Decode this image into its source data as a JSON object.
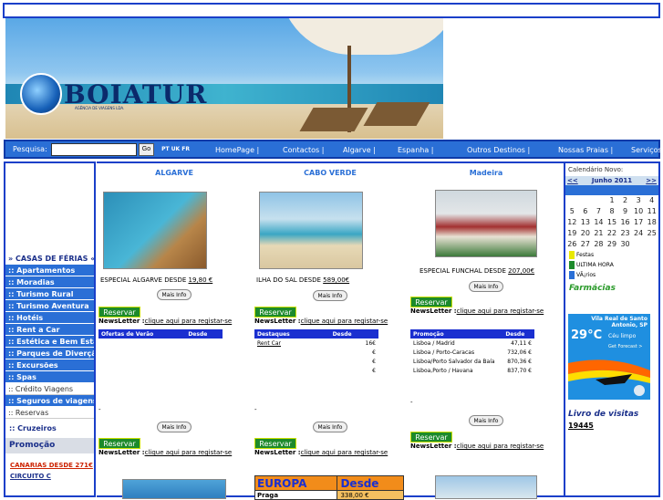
{
  "brand": {
    "name": "BOIATUR",
    "subtitle": "AGÊNCIA DE VIAGENS LDA."
  },
  "nav": {
    "search_label": "Pesquisa:",
    "go": "Go",
    "langs": "PT UK FR",
    "links": [
      "HomePage",
      "Contactos",
      "Algarve",
      "Espanha",
      "Outros Destinos",
      "Nossas Praias",
      "Serviços"
    ]
  },
  "sidebar": {
    "items": [
      {
        "label": "» CASAS DE FÉRIAS «",
        "style": "white"
      },
      {
        "label": ":: Apartamentos",
        "style": "blue"
      },
      {
        "label": ":: Moradias",
        "style": "blue"
      },
      {
        "label": ":: Turismo Rural",
        "style": "blue"
      },
      {
        "label": ":: Turismo Aventura",
        "style": "blue"
      },
      {
        "label": ":: Hotéis",
        "style": "blue"
      },
      {
        "label": ":: Rent a Car",
        "style": "blue"
      },
      {
        "label": ":: Estética e Bem Estar",
        "style": "blue"
      },
      {
        "label": ":: Parques de Diverçã",
        "style": "blue"
      },
      {
        "label": ":: Excursões",
        "style": "blue"
      },
      {
        "label": ":: Spas",
        "style": "blue"
      },
      {
        "label": ":: Crédito Viagens",
        "style": "plain"
      },
      {
        "label": ":: Seguros de viagens",
        "style": "blue"
      },
      {
        "label": ":: Reservas",
        "style": "plain"
      }
    ],
    "cruzeiros": ":: Cruzeiros",
    "promocao": "Promoção",
    "canarias": "CANARIAS DESDE 271€",
    "circuito": "CIRCUITO C"
  },
  "columns": [
    {
      "title": "ALGARVE",
      "caption": "ESPECIAL ALGARVE DESDE",
      "price": "19,80 €"
    },
    {
      "title": "CABO VERDE",
      "caption": "ILHA DO SAL DESDE",
      "price": "589,00€"
    },
    {
      "title": "Madeira",
      "caption": "ESPECIAL FUNCHAL DESDE",
      "price": "207,00€"
    }
  ],
  "buttons": {
    "mais_info": "Mais Info",
    "reservar": "Reservar"
  },
  "newsletter": {
    "label": "NewsLetter :",
    "link": "clique aqui para registar-se"
  },
  "tables": {
    "t1": {
      "headers": [
        "Ofertas de Verão",
        "Desde"
      ]
    },
    "t2": {
      "headers": [
        "Destaques",
        "Desde"
      ],
      "rows": [
        [
          "Rent Car",
          "16€"
        ],
        [
          "",
          "€"
        ],
        [
          "",
          "€"
        ],
        [
          "",
          "€"
        ]
      ]
    },
    "t3": {
      "headers": [
        "Promoção",
        "Desde"
      ],
      "rows": [
        [
          "Lisboa / Madrid",
          "47,11 €"
        ],
        [
          "Lisboa / Porto-Caracas",
          "732,06 €"
        ],
        [
          "Lisboa/Porto Salvador da Baía",
          "870,36 €"
        ],
        [
          "Lisboa,Porto / Havana",
          "837,70 €"
        ]
      ]
    }
  },
  "europa": {
    "label": "EUROPA",
    "desde": "Desde",
    "city": "Praga",
    "price": "338,00 €"
  },
  "calendar": {
    "title": "Calendário Novo:",
    "prev": "<<",
    "month": "Junho 2011",
    "next": ">>",
    "days": [
      "",
      "",
      "",
      "1",
      "2",
      "3",
      "4",
      "5",
      "6",
      "7",
      "8",
      "9",
      "10",
      "11",
      "12",
      "13",
      "14",
      "15",
      "16",
      "17",
      "18",
      "19",
      "20",
      "21",
      "22",
      "23",
      "24",
      "25",
      "26",
      "27",
      "28",
      "29",
      "30",
      "",
      ""
    ],
    "legend": [
      {
        "label": "Festas",
        "color": "#e8e800"
      },
      {
        "label": "ULTIMA HORA",
        "color": "#1c8a2b"
      },
      {
        "label": "VÃ¡rios",
        "color": "#2a6fd6"
      }
    ]
  },
  "farmacias": "Farmácias",
  "weather": {
    "place": "Vila Real de Santo Antonio, SP",
    "temp": "29°C",
    "condition": "Céu limpo",
    "forecast": "Get Forecast >"
  },
  "livro": {
    "title": "Livro de visitas",
    "count": "19445"
  },
  "dash": "-"
}
